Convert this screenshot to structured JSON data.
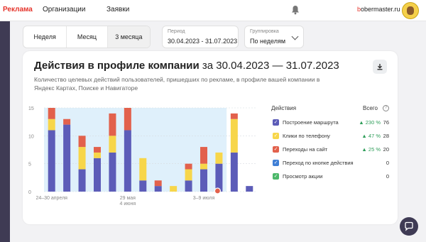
{
  "topbar": {
    "brand": "Реклама",
    "nav": [
      "Организации",
      "Заявки"
    ],
    "user_prefix": "b",
    "user_rest": "obermaster.ru"
  },
  "filters": {
    "periods": [
      "Неделя",
      "Месяц",
      "3 месяца"
    ],
    "active_period": "3 месяца",
    "date_label": "Период",
    "date_value": "30.04.2023 - 31.07.2023",
    "group_label": "Группировка",
    "group_value": "По неделям"
  },
  "card": {
    "title": "Действия в профиле компании",
    "period": "за 30.04.2023 — 31.07.2023",
    "description": "Количество целевых действий пользователей, пришедших по рекламе, в профиле вашей компании в Яндекс Картах, Поиске и Навигаторе"
  },
  "legend": {
    "title": "Действия",
    "total_label": "Всего",
    "info_icon": "?",
    "items": [
      {
        "label": "Построение маршрута",
        "delta": "▲ 230 %",
        "total": "76",
        "color": "#5c5cb8",
        "checked": true
      },
      {
        "label": "Клики по телефону",
        "delta": "▲ 47 %",
        "total": "28",
        "color": "#f7d64a",
        "checked": true
      },
      {
        "label": "Переходы на сайт",
        "delta": "▲ 25 %",
        "total": "20",
        "color": "#e2614c",
        "checked": true
      },
      {
        "label": "Переход по кнопке действия",
        "delta": "",
        "total": "0",
        "color": "#3f7fd6",
        "checked": true
      },
      {
        "label": "Просмотр акции",
        "delta": "",
        "total": "0",
        "color": "#4cb86a",
        "checked": true
      }
    ]
  },
  "chart_data": {
    "type": "bar",
    "stacked": true,
    "ylim": [
      0,
      15
    ],
    "yticks": [
      0,
      5,
      10,
      15
    ],
    "x_tick_labels": [
      {
        "label": "24–30 апреля",
        "index": 0
      },
      {
        "label": "29 мая\n4 июня",
        "index": 5
      },
      {
        "label": "3–9 июля",
        "index": 10
      }
    ],
    "shaded_until_index": 12,
    "marker_index": 11,
    "series": [
      {
        "name": "Построение маршрута",
        "color": "#5c5cb8",
        "values": [
          11,
          12,
          4,
          6,
          7,
          11,
          2,
          1,
          0,
          2,
          4,
          5,
          7,
          1
        ]
      },
      {
        "name": "Клики по телефону",
        "color": "#f7d64a",
        "values": [
          2,
          0,
          4,
          1,
          3,
          0,
          4,
          0,
          1,
          2,
          1,
          2,
          6,
          0
        ]
      },
      {
        "name": "Переходы на сайт",
        "color": "#e2614c",
        "values": [
          2,
          1,
          2,
          1,
          4,
          4,
          0,
          1,
          0,
          1,
          3,
          0,
          1,
          0
        ]
      }
    ]
  },
  "icons": {
    "bell": "bell-icon",
    "download": "download-icon",
    "chat": "chat-icon"
  }
}
